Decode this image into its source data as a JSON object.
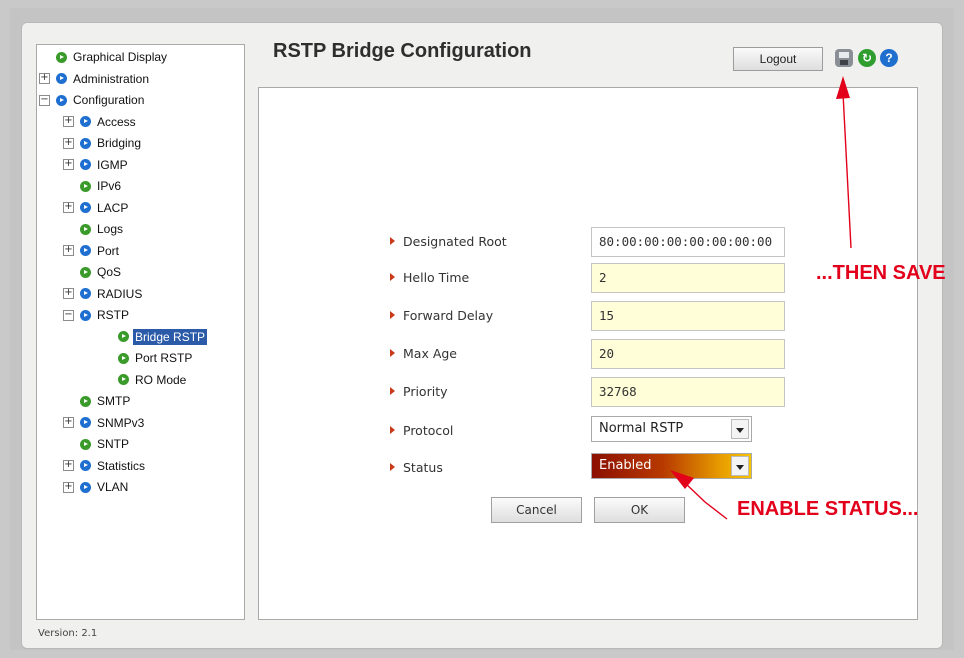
{
  "page": {
    "title": "RSTP Bridge Configuration",
    "version": "Version: 2.1"
  },
  "header": {
    "logout_label": "Logout",
    "help_label": "?",
    "refresh_label": "↻"
  },
  "tree": [
    {
      "label": "Graphical Display",
      "expander": "",
      "level": 0,
      "name": "tree-item-graphical-display",
      "selected": false
    },
    {
      "label": "Administration",
      "expander": "+",
      "level": 0,
      "name": "tree-item-administration",
      "selected": false
    },
    {
      "label": "Configuration",
      "expander": "−",
      "level": 0,
      "name": "tree-item-configuration",
      "selected": false
    },
    {
      "label": "Access",
      "expander": "+",
      "level": 1,
      "name": "tree-item-access",
      "selected": false
    },
    {
      "label": "Bridging",
      "expander": "+",
      "level": 1,
      "name": "tree-item-bridging",
      "selected": false
    },
    {
      "label": "IGMP",
      "expander": "+",
      "level": 1,
      "name": "tree-item-igmp",
      "selected": false
    },
    {
      "label": "IPv6",
      "expander": "",
      "level": 1,
      "name": "tree-item-ipv6",
      "selected": false
    },
    {
      "label": "LACP",
      "expander": "+",
      "level": 1,
      "name": "tree-item-lacp",
      "selected": false
    },
    {
      "label": "Logs",
      "expander": "",
      "level": 1,
      "name": "tree-item-logs",
      "selected": false
    },
    {
      "label": "Port",
      "expander": "+",
      "level": 1,
      "name": "tree-item-port",
      "selected": false
    },
    {
      "label": "QoS",
      "expander": "",
      "level": 1,
      "name": "tree-item-qos",
      "selected": false
    },
    {
      "label": "RADIUS",
      "expander": "+",
      "level": 1,
      "name": "tree-item-radius",
      "selected": false
    },
    {
      "label": "RSTP",
      "expander": "−",
      "level": 1,
      "name": "tree-item-rstp",
      "selected": false
    },
    {
      "label": "Bridge RSTP",
      "expander": "",
      "level": 2,
      "name": "tree-item-bridge-rstp",
      "selected": true
    },
    {
      "label": "Port RSTP",
      "expander": "",
      "level": 2,
      "name": "tree-item-port-rstp",
      "selected": false
    },
    {
      "label": "RO Mode",
      "expander": "",
      "level": 2,
      "name": "tree-item-ro-mode",
      "selected": false
    },
    {
      "label": "SMTP",
      "expander": "",
      "level": 1,
      "name": "tree-item-smtp",
      "selected": false
    },
    {
      "label": "SNMPv3",
      "expander": "+",
      "level": 1,
      "name": "tree-item-snmpv3",
      "selected": false
    },
    {
      "label": "SNTP",
      "expander": "",
      "level": 1,
      "name": "tree-item-sntp",
      "selected": false
    },
    {
      "label": "Statistics",
      "expander": "+",
      "level": 1,
      "name": "tree-item-statistics",
      "selected": false
    },
    {
      "label": "VLAN",
      "expander": "+",
      "level": 1,
      "name": "tree-item-vlan",
      "selected": false
    }
  ],
  "form": {
    "designated_root": {
      "label": "Designated Root",
      "value": "80:00:00:00:00:00:00:00"
    },
    "hello_time": {
      "label": "Hello Time",
      "value": "2"
    },
    "forward_delay": {
      "label": "Forward Delay",
      "value": "15"
    },
    "max_age": {
      "label": "Max Age",
      "value": "20"
    },
    "priority": {
      "label": "Priority",
      "value": "32768"
    },
    "protocol": {
      "label": "Protocol",
      "value": "Normal RSTP"
    },
    "status": {
      "label": "Status",
      "value": "Enabled"
    },
    "cancel_label": "Cancel",
    "ok_label": "OK"
  },
  "annotations": {
    "save_callout": "...THEN SAVE",
    "status_callout": "ENABLE STATUS..."
  },
  "colors": {
    "callout": "#e3001b",
    "input_fill": "#fffed9",
    "selected_tree": "#2a5aa8"
  }
}
